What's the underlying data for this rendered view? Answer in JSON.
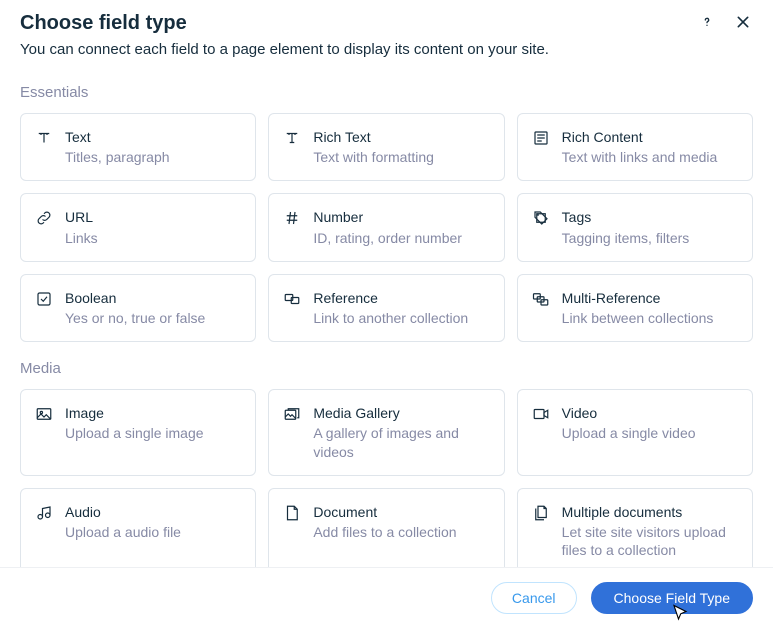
{
  "header": {
    "title": "Choose field type",
    "subtitle": "You can connect each field to a page element to display its content on your site."
  },
  "sections": {
    "essentials": {
      "label": "Essentials",
      "items": [
        {
          "icon": "text-icon",
          "title": "Text",
          "desc": "Titles, paragraph"
        },
        {
          "icon": "rich-text-icon",
          "title": "Rich Text",
          "desc": "Text with formatting"
        },
        {
          "icon": "rich-content-icon",
          "title": "Rich Content",
          "desc": "Text with links and media"
        },
        {
          "icon": "url-icon",
          "title": "URL",
          "desc": "Links"
        },
        {
          "icon": "number-icon",
          "title": "Number",
          "desc": "ID, rating, order number"
        },
        {
          "icon": "tags-icon",
          "title": "Tags",
          "desc": "Tagging items, filters"
        },
        {
          "icon": "boolean-icon",
          "title": "Boolean",
          "desc": "Yes or no, true or false"
        },
        {
          "icon": "reference-icon",
          "title": "Reference",
          "desc": "Link to another collection"
        },
        {
          "icon": "multi-reference-icon",
          "title": "Multi-Reference",
          "desc": "Link between collections"
        }
      ]
    },
    "media": {
      "label": "Media",
      "items": [
        {
          "icon": "image-icon",
          "title": "Image",
          "desc": "Upload a single image"
        },
        {
          "icon": "media-gallery-icon",
          "title": "Media Gallery",
          "desc": "A gallery of images and videos"
        },
        {
          "icon": "video-icon",
          "title": "Video",
          "desc": "Upload a single video"
        },
        {
          "icon": "audio-icon",
          "title": "Audio",
          "desc": "Upload a audio file"
        },
        {
          "icon": "document-icon",
          "title": "Document",
          "desc": "Add files to a collection"
        },
        {
          "icon": "multiple-documents-icon",
          "title": "Multiple documents",
          "desc": "Let site site visitors upload files to a collection"
        }
      ]
    }
  },
  "footer": {
    "cancel": "Cancel",
    "choose": "Choose Field Type"
  }
}
